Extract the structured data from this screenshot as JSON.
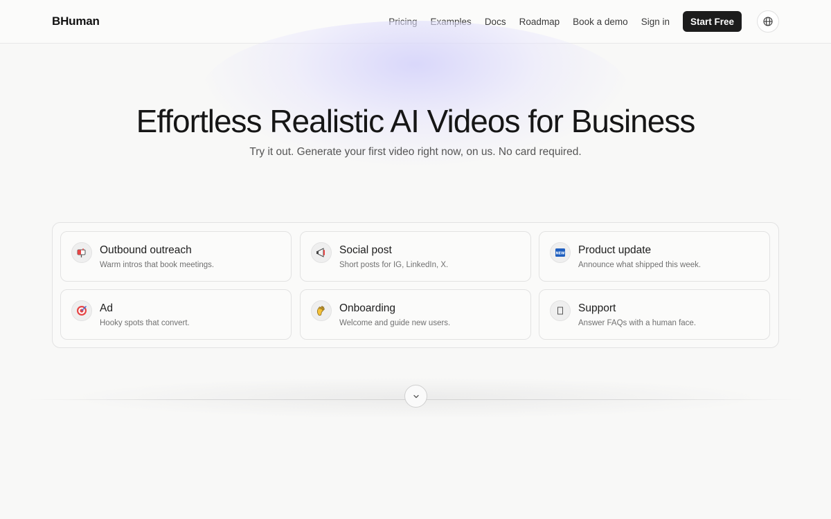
{
  "header": {
    "logo": "BHuman",
    "nav": [
      "Pricing",
      "Examples",
      "Docs",
      "Roadmap",
      "Book a demo",
      "Sign in"
    ],
    "cta": "Start Free",
    "language_icon": "globe-icon"
  },
  "hero": {
    "title": "Effortless Realistic AI Videos for Business",
    "subtitle": "Try it out. Generate your first video right now, on us. No card required."
  },
  "use_cases": [
    {
      "title": "Outbound outreach",
      "desc": "Warm intros that book meetings.",
      "icon": "mailbox-icon"
    },
    {
      "title": "Social post",
      "desc": "Short posts for IG, LinkedIn, X.",
      "icon": "megaphone-icon"
    },
    {
      "title": "Product update",
      "desc": "Announce what shipped this week.",
      "icon": "new-badge-icon"
    },
    {
      "title": "Ad",
      "desc": "Hooky spots that convert.",
      "icon": "target-icon"
    },
    {
      "title": "Onboarding",
      "desc": "Welcome and guide new users.",
      "icon": "waving-hand-icon"
    },
    {
      "title": "Support",
      "desc": "Answer FAQs with a human face.",
      "icon": "placeholder-glyph-icon"
    }
  ],
  "colors": {
    "cta_bg": "#1c1c1c",
    "page_bg": "#f8f8f7",
    "glow": "#dcdaf8"
  },
  "scroll_icon": "chevron-down-icon"
}
